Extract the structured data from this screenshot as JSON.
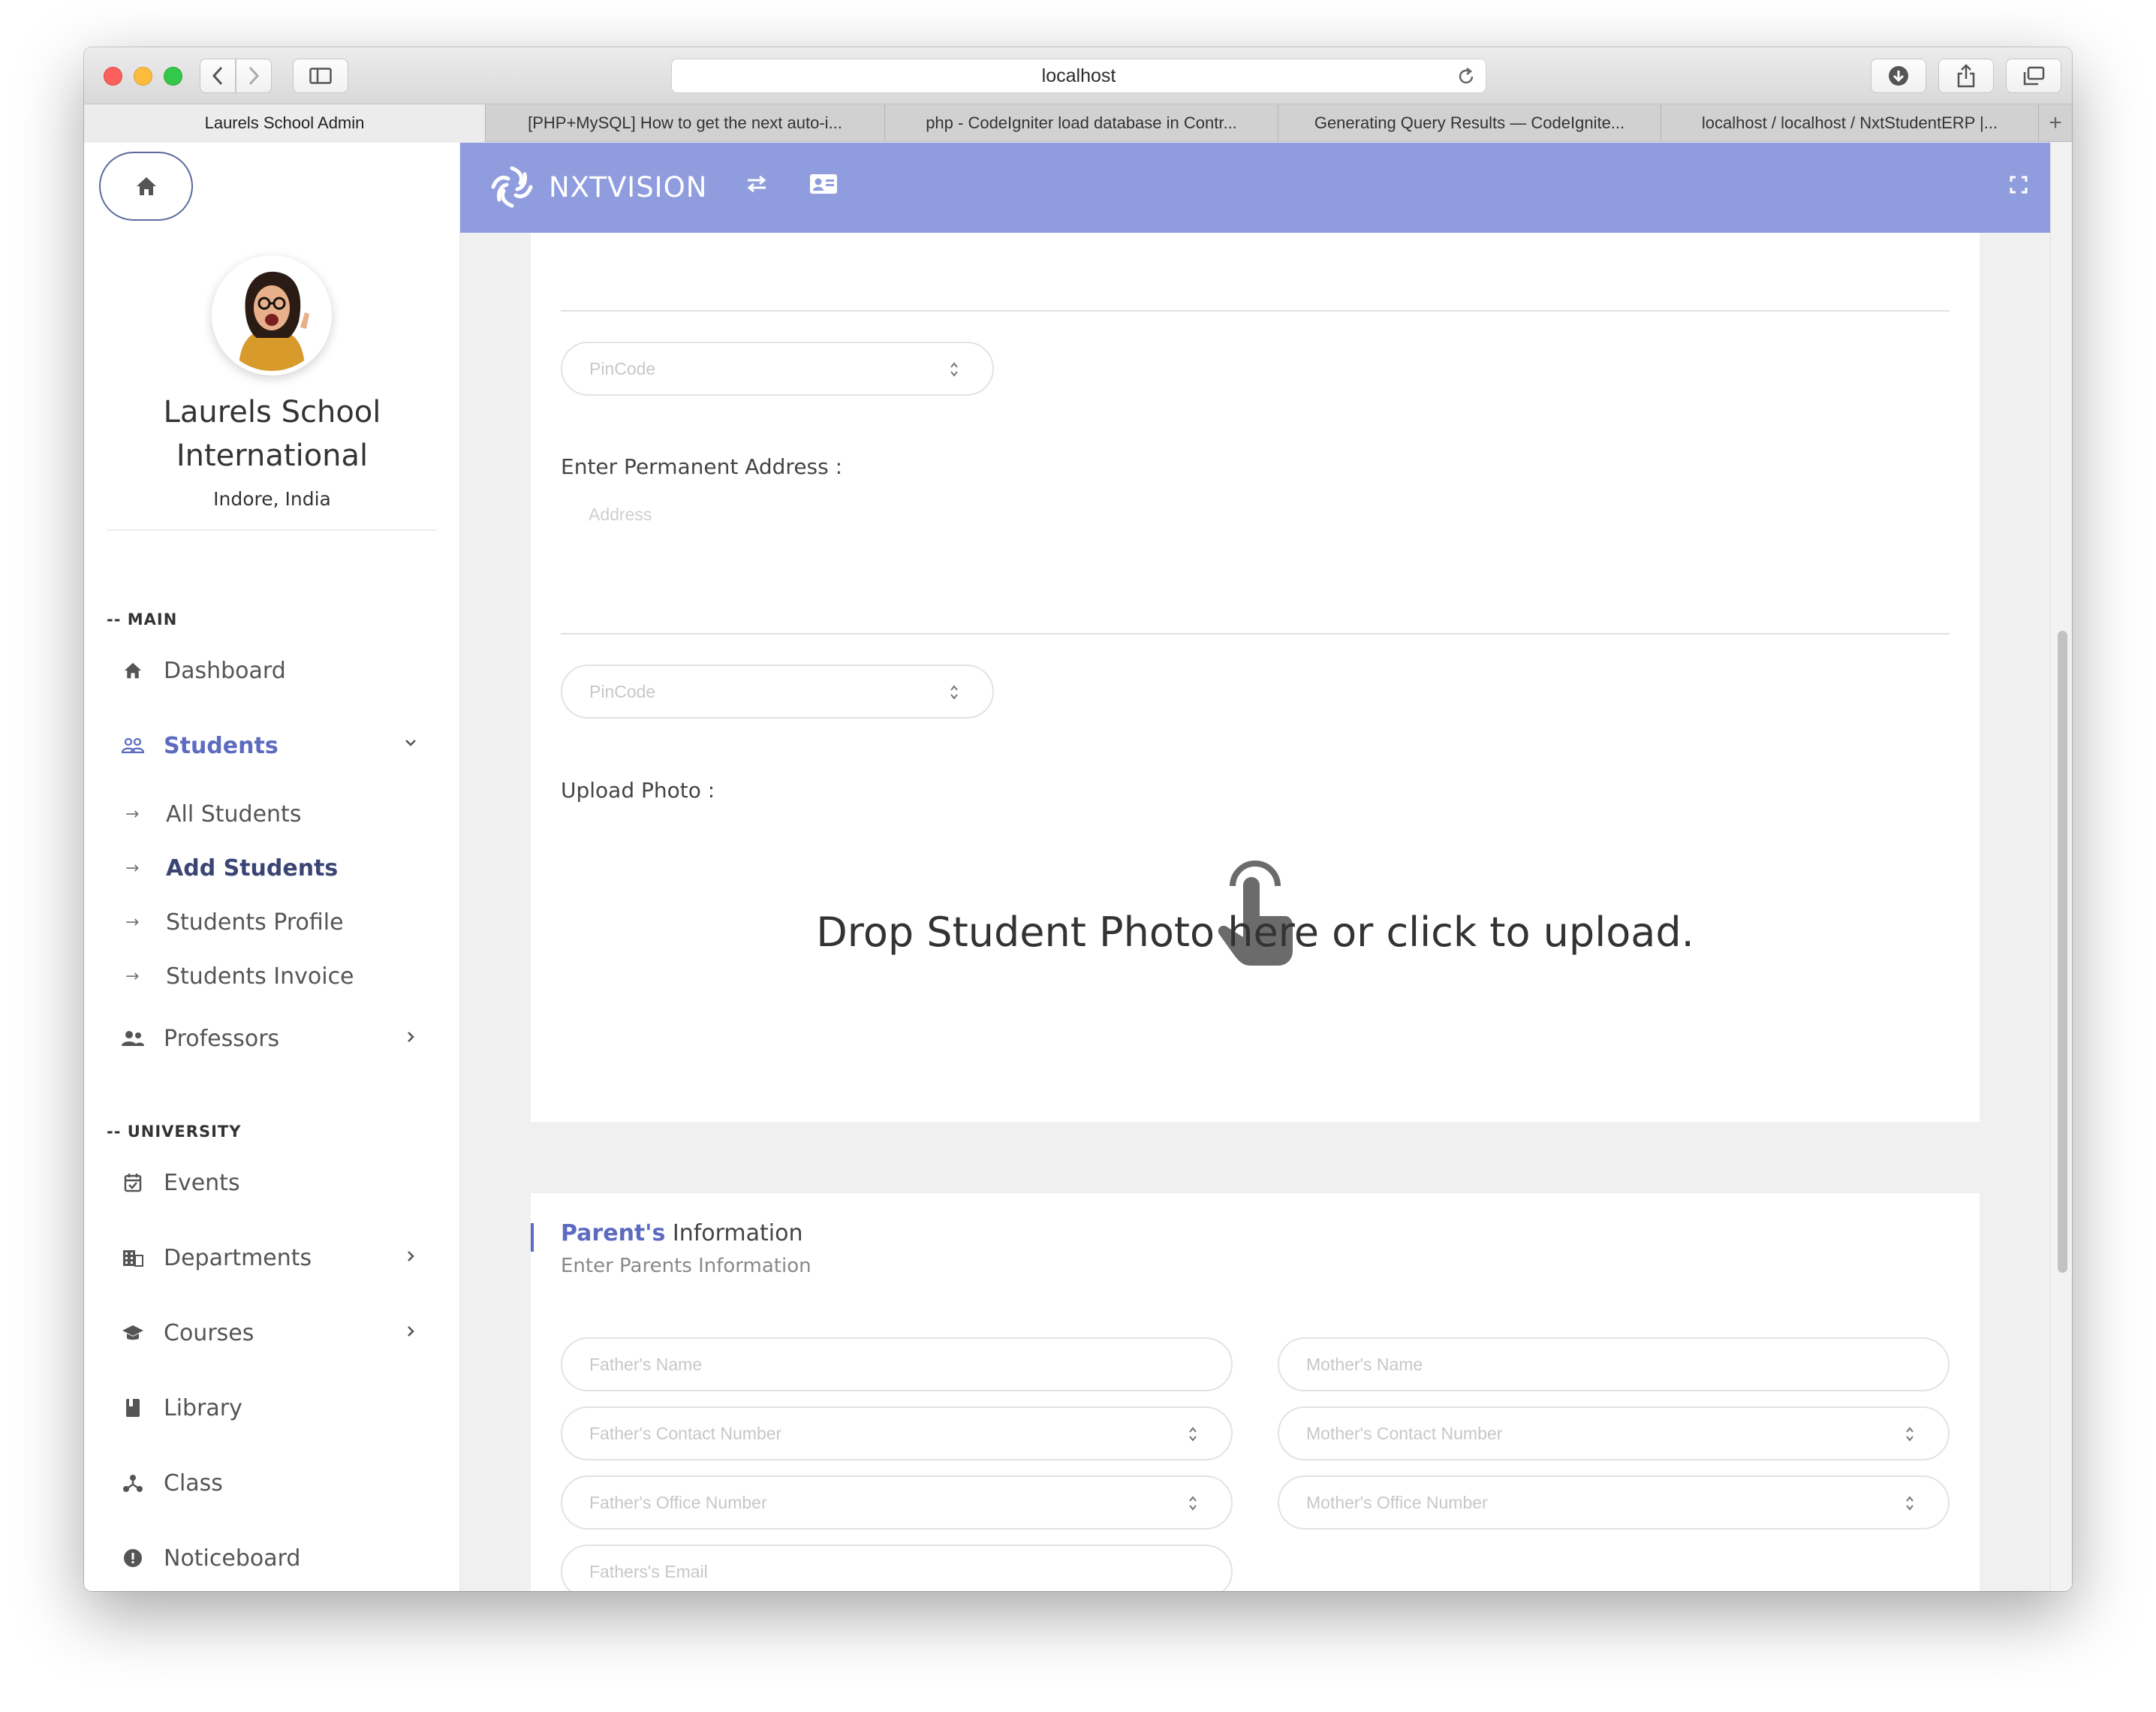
{
  "browser": {
    "url": "localhost",
    "tabs": [
      {
        "title": "Laurels School Admin",
        "active": true
      },
      {
        "title": "[PHP+MySQL] How to get the next auto-i..."
      },
      {
        "title": "php - CodeIgniter load database in Contr..."
      },
      {
        "title": "Generating Query Results — CodeIgnite..."
      },
      {
        "title": "localhost / localhost / NxtStudentERP |..."
      }
    ]
  },
  "sidebar": {
    "school_name_line1": "Laurels School",
    "school_name_line2": "International",
    "location": "Indore, India",
    "section_main": "-- MAIN",
    "section_university": "-- UNIVERSITY",
    "items": {
      "dashboard": "Dashboard",
      "students": "Students",
      "all_students": "All Students",
      "add_students": "Add Students",
      "students_profile": "Students Profile",
      "students_invoice": "Students Invoice",
      "professors": "Professors",
      "events": "Events",
      "departments": "Departments",
      "courses": "Courses",
      "library": "Library",
      "class": "Class",
      "noticeboard": "Noticeboard"
    }
  },
  "header": {
    "brand": "NXTVISION",
    "accent_color": "#8f9ddf"
  },
  "form": {
    "pincode_placeholder": "PinCode",
    "permanent_address_label": "Enter Permanent Address :",
    "address_placeholder": "Address",
    "permanent_pincode_placeholder": "PinCode",
    "upload_photo_label": "Upload Photo :",
    "dropzone_text": "Drop Student Photo here or click to upload."
  },
  "parents": {
    "title_strong": "Parent's",
    "title_rest": " Information",
    "subtitle": "Enter Parents Information",
    "fathers_name": "Father's Name",
    "mothers_name": "Mother's Name",
    "fathers_contact": "Father's Contact Number",
    "mothers_contact": "Mother's Contact Number",
    "fathers_office": "Father's Office Number",
    "mothers_office": "Mother's Office Number",
    "fathers_email": "Fathers's Email"
  }
}
